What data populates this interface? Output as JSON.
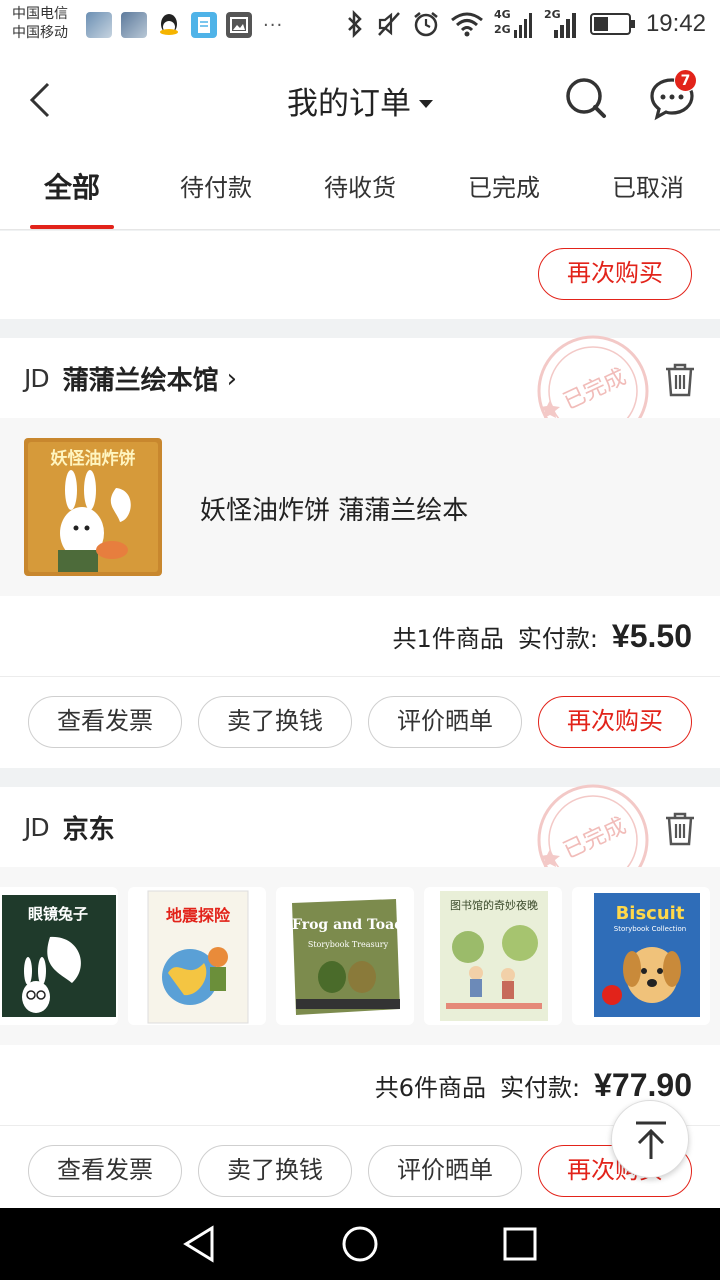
{
  "status_bar": {
    "carrier_1": "中国电信",
    "carrier_2": "中国移动",
    "network_1": "4G",
    "network_2": "2G",
    "network_3": "2G",
    "time": "19:42",
    "app_icons": [
      "gallery-app-icon",
      "gallery-app-icon",
      "qq-icon",
      "notes-app-icon",
      "photos-app-icon"
    ],
    "more_indicator": "···"
  },
  "header": {
    "title": "我的订单",
    "message_badge": "7"
  },
  "tabs": [
    {
      "label": "全部",
      "active": true
    },
    {
      "label": "待付款",
      "active": false
    },
    {
      "label": "待收货",
      "active": false
    },
    {
      "label": "已完成",
      "active": false
    },
    {
      "label": "已取消",
      "active": false
    }
  ],
  "top_partial": {
    "rebuy_label": "再次购买"
  },
  "orders": [
    {
      "logo": "JD",
      "store": "蒲蒲兰绘本馆",
      "stamp": "已完成",
      "item_title": "妖怪油炸饼 蒲蒲兰绘本",
      "cover_title": "妖怪油炸饼",
      "count_text": "共1件商品",
      "paid_label": "实付款:",
      "price": "¥5.50",
      "buttons": [
        "查看发票",
        "卖了换钱",
        "评价晒单",
        "再次购买"
      ]
    },
    {
      "logo": "JD",
      "store": "京东",
      "stamp": "已完成",
      "covers": [
        {
          "title": "眼镜兔子"
        },
        {
          "title": "地震探险"
        },
        {
          "title": "Frog and Toad",
          "subtitle": "Storybook Treasury"
        },
        {
          "title": "图书馆的奇妙夜晚"
        },
        {
          "title": "Biscuit",
          "subtitle": "Storybook Collection"
        }
      ],
      "count_text": "共6件商品",
      "paid_label": "实付款:",
      "price": "¥77.90",
      "buttons": [
        "查看发票",
        "卖了换钱",
        "评价晒单",
        "再次购买"
      ]
    }
  ],
  "colors": {
    "accent": "#e2231a",
    "page_bg": "#f0f2f3"
  }
}
